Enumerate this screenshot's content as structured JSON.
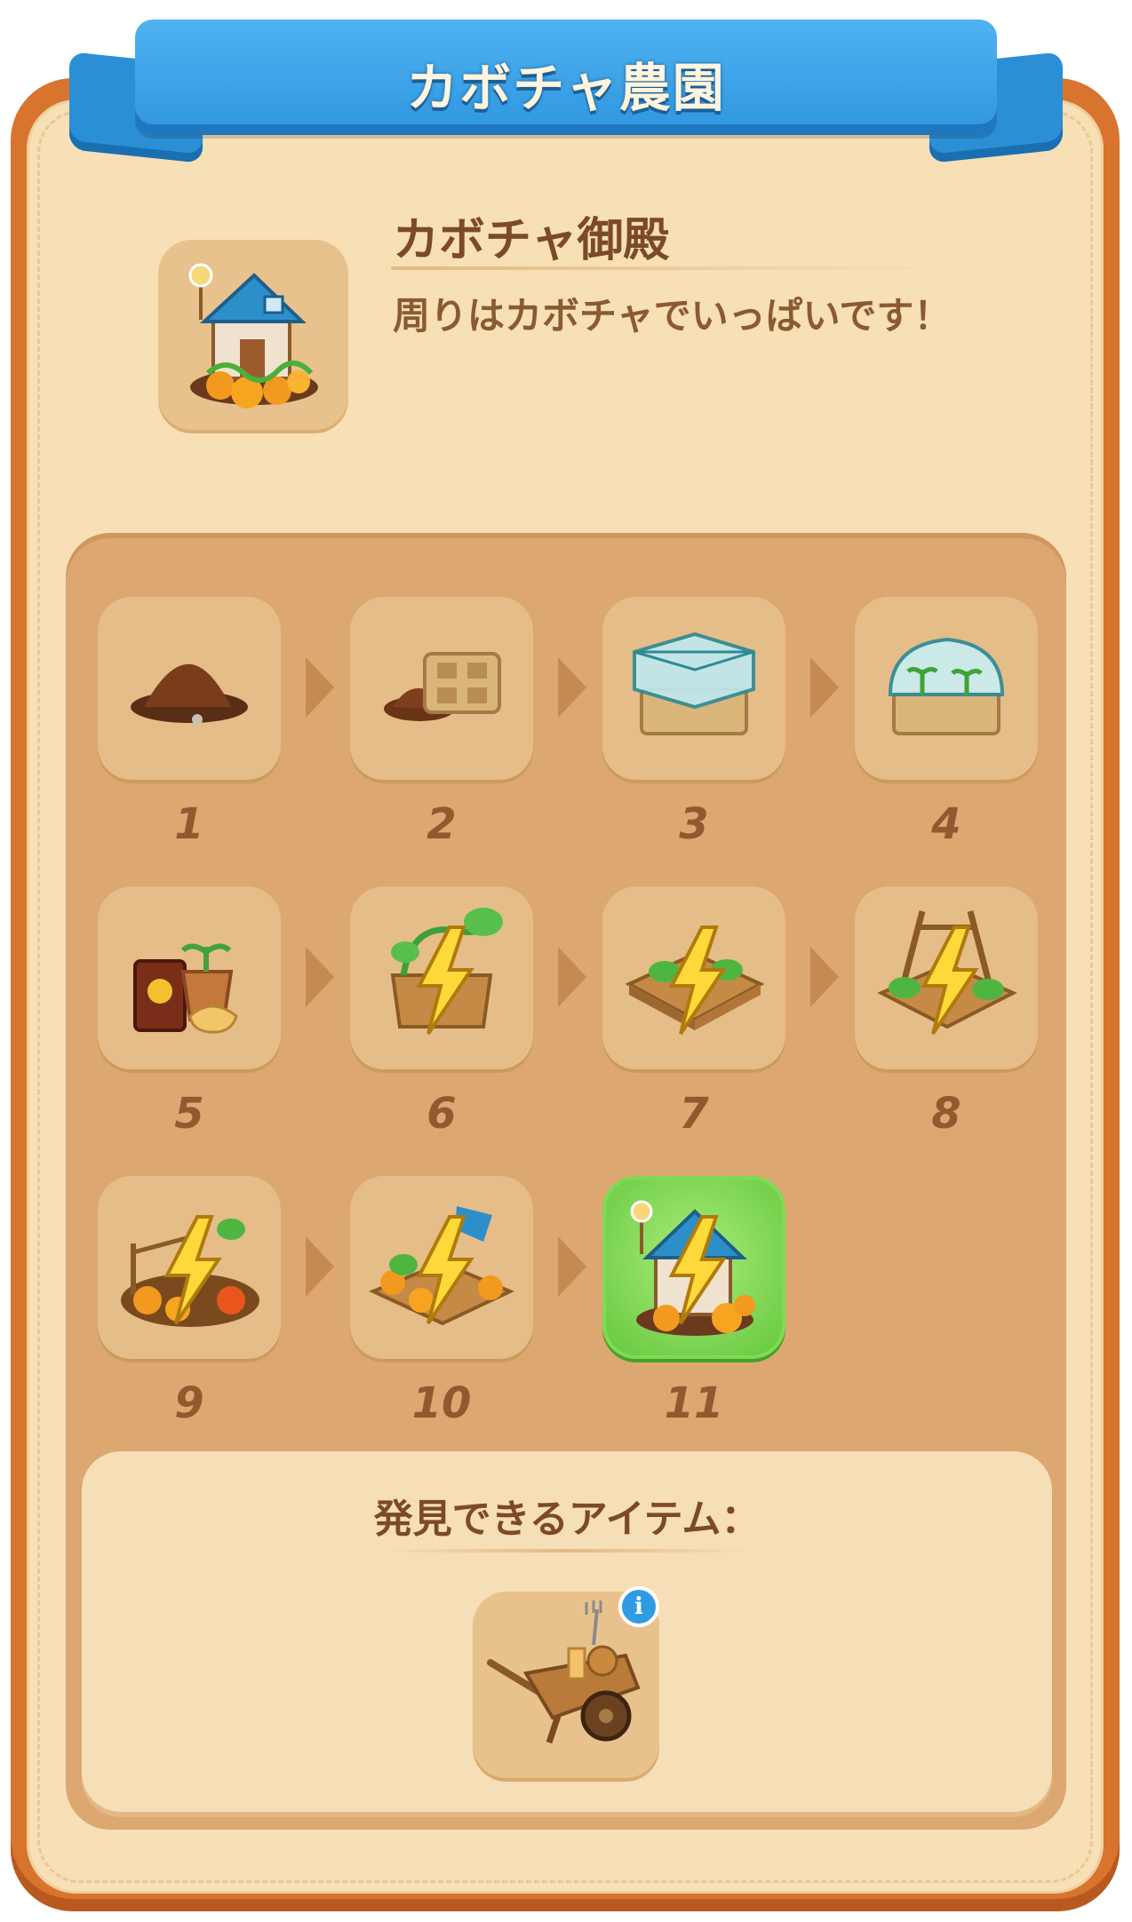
{
  "header": {
    "title": "カボチャ農園"
  },
  "featured": {
    "name": "カボチャ御殿",
    "description": "周りはカボチャでいっぱいです！",
    "icon": "pumpkin-mansion-icon"
  },
  "steps": [
    {
      "label": "1",
      "icon": "dirt-pile-icon"
    },
    {
      "label": "2",
      "icon": "seed-tray-icon"
    },
    {
      "label": "3",
      "icon": "glass-planter-icon"
    },
    {
      "label": "4",
      "icon": "mini-greenhouse-icon"
    },
    {
      "label": "5",
      "icon": "seed-bag-pot-icon"
    },
    {
      "label": "6",
      "icon": "vine-planter-icon"
    },
    {
      "label": "7",
      "icon": "pumpkin-bed-icon"
    },
    {
      "label": "8",
      "icon": "trellis-bed-icon"
    },
    {
      "label": "9",
      "icon": "pumpkin-patch-icon"
    },
    {
      "label": "10",
      "icon": "large-pumpkin-patch-icon"
    },
    {
      "label": "11",
      "icon": "pumpkin-mansion-icon"
    }
  ],
  "current_step": "11",
  "discoverable": {
    "title": "発見できるアイテム：",
    "items": [
      {
        "icon": "wheelbarrow-icon",
        "info_icon": "info-icon",
        "info_glyph": "i"
      }
    ]
  },
  "colors": {
    "frame": "#d8742e",
    "ribbon": "#2f95de",
    "panel": "#dca770",
    "active_tile": "#64c73d",
    "text": "#7c4a26"
  }
}
